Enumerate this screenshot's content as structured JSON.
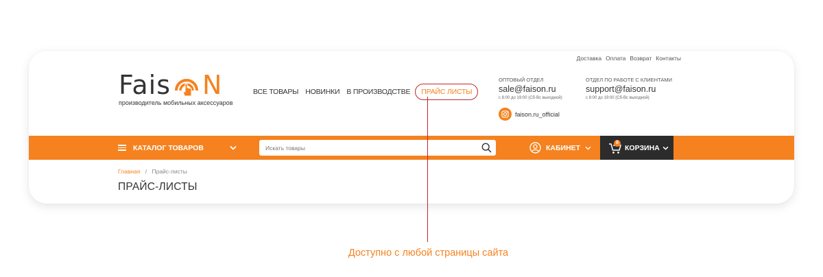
{
  "top_links": [
    "Доставка",
    "Оплата",
    "Возврат",
    "Контакты"
  ],
  "logo": {
    "text": "Fais",
    "letter": "N",
    "tagline": "производитель мобильных аксессуаров",
    "color": "#f5821f"
  },
  "nav": {
    "items": [
      "ВСЕ ТОВАРЫ",
      "НОВИНКИ",
      "В ПРОИЗВОДСТВЕ"
    ],
    "highlight": "ПРАЙС ЛИСТЫ"
  },
  "contacts": {
    "wholesale": {
      "label": "ОПТОВЫЙ ОТДЕЛ",
      "email": "sale@faison.ru",
      "hours": "с 8:00 до 19:00 (Сб-Вс выходной)"
    },
    "support": {
      "label": "ОТДЕЛ ПО РАБОТЕ С КЛИЕНТАМИ",
      "email": "support@faison.ru",
      "hours": "с 8:00 до 19:00 (Сб-Вс выходной)"
    },
    "instagram": "faison.ru_official"
  },
  "bar": {
    "catalog_label": "КАТАЛОГ ТОВАРОВ",
    "search_placeholder": "Искать товары",
    "cabinet_label": "КАБИНЕТ",
    "cart_label": "КОРЗИНА",
    "cart_count": "0",
    "accent": "#f5821f",
    "cart_bg": "#2c2c2c"
  },
  "breadcrumb": {
    "home": "Главная",
    "separator": "/",
    "current": "Прайс-листы"
  },
  "page_title": "ПРАЙС-ЛИСТЫ",
  "annotation": {
    "text": "Доступно с любой страницы сайта",
    "line_color": "#c0282e"
  }
}
